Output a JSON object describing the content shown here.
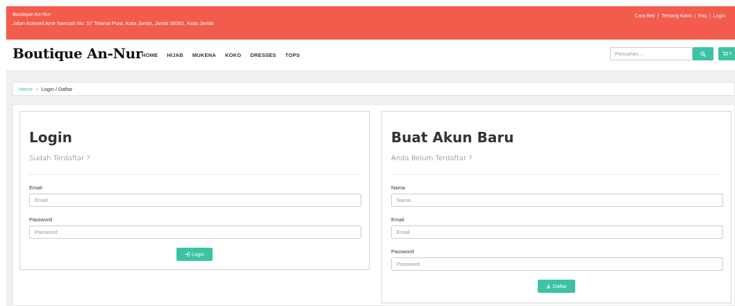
{
  "topbar": {
    "shop_name": "Boutique An-Nur",
    "address": "Jalan Kolonel Amir hamzah No. 57 Telanai Pura, Kota Jambi, Jambi 36361, Kota Jambi",
    "links": [
      "Cara Beli",
      "Tentang Kami",
      "Faq",
      "Login"
    ],
    "separator": "|"
  },
  "navbar": {
    "brand": "Boutique An-Nur",
    "menu": [
      "HOME",
      "HIJAB",
      "MUKENA",
      "KOKO",
      "DRESSES",
      "TOPS"
    ],
    "search_placeholder": "Pencarian...",
    "cart_count": "0"
  },
  "breadcrumb": {
    "home": "Home",
    "separator": ">",
    "current": "Login / Daftar"
  },
  "login": {
    "title": "Login",
    "subtitle": "Sudah Terdaftar ?",
    "email_label": "Email",
    "email_placeholder": "Email",
    "password_label": "Password",
    "password_placeholder": "Password",
    "button_label": "Login"
  },
  "register": {
    "title": "Buat Akun Baru",
    "subtitle": "Anda Belum Terdaftar ?",
    "name_label": "Nama",
    "name_placeholder": "Nama",
    "email_label": "Email",
    "email_placeholder": "Email",
    "password_label": "Password",
    "password_placeholder": "Password",
    "button_label": "Daftar"
  },
  "colors": {
    "topbar": "#f35b4d",
    "accent": "#3cc3a4",
    "background": "#f0f0f0"
  },
  "icons": {
    "search": "search-icon",
    "cart": "cart-icon",
    "login": "sign-in-icon",
    "register": "download-icon"
  }
}
